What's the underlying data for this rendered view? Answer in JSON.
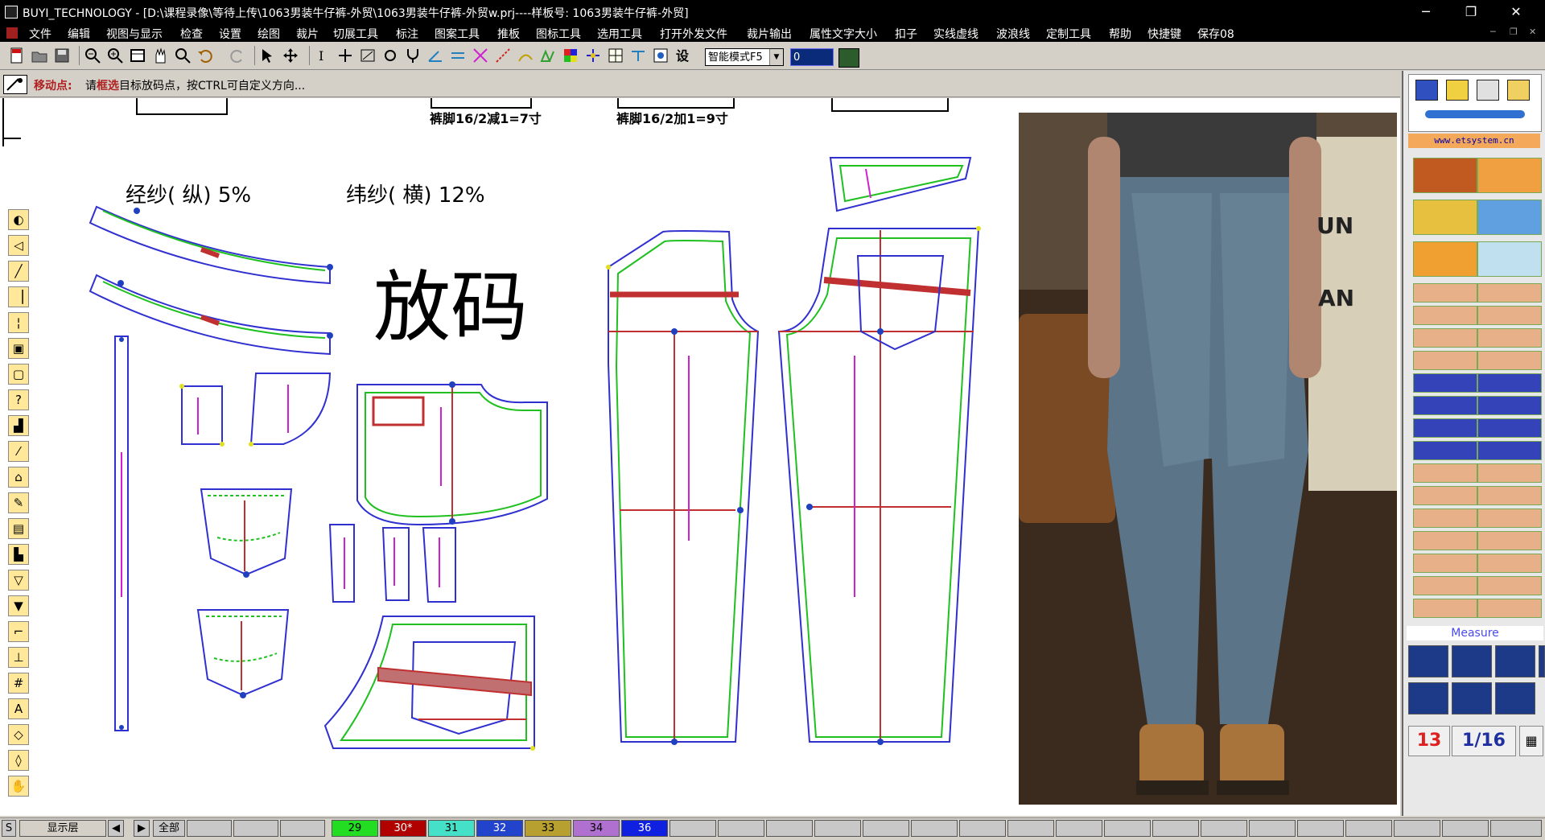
{
  "window": {
    "title": "BUYI_TECHNOLOGY - [D:\\课程录像\\等待上传\\1063男装牛仔裤-外贸\\1063男装牛仔裤-外贸w.prj----样板号: 1063男装牛仔裤-外贸]",
    "min": "─",
    "restore": "❐",
    "close": "✕"
  },
  "menu": [
    "文件",
    "编辑",
    "视图与显示",
    "检查",
    "设置",
    "绘图",
    "裁片",
    "切展工具",
    "标注",
    "图案工具",
    "推板",
    "图标工具",
    "选用工具",
    "打开外发文件",
    "裁片输出",
    "属性文字大小",
    "扣子",
    "实线虚线",
    "波浪线",
    "定制工具",
    "帮助",
    "快捷键",
    "保存08"
  ],
  "toolbar": {
    "mode": "智能模式F5",
    "number_value": "0"
  },
  "status": {
    "label": "移动点:",
    "msg_a": "请",
    "msg_hl": "框选",
    "msg_b": "目标放码点，按CTRL可自定义方向..."
  },
  "canvas": {
    "heading": "放码",
    "warp": "经纱(  纵)  5%",
    "weft": "纬纱(  横)  12%",
    "note_left": "裤脚16/2减1=7寸",
    "note_right": "裤脚16/2加1=9寸"
  },
  "right_panel": {
    "url": "www.etsystem.cn",
    "measure": "Measure",
    "counter": "13",
    "fraction": "1/16"
  },
  "layer_bar": {
    "s_label": "S",
    "display_layer": "显示层",
    "prev": "◀",
    "next": "▶",
    "all": "全部",
    "sizes": [
      {
        "label": "29",
        "color": "#22dd22"
      },
      {
        "label": "30*",
        "color": "#b00000"
      },
      {
        "label": "31",
        "color": "#44e0c8"
      },
      {
        "label": "32",
        "color": "#2244cc"
      },
      {
        "label": "33",
        "color": "#b8a030"
      },
      {
        "label": "34",
        "color": "#b070d0"
      },
      {
        "label": "36",
        "color": "#1020e0"
      }
    ]
  },
  "colors": {
    "outline": "#3030d0",
    "grade_green": "#20c020",
    "grade_violet": "#a070d0",
    "stripe": "#c03030",
    "grain": "#d020d0"
  }
}
